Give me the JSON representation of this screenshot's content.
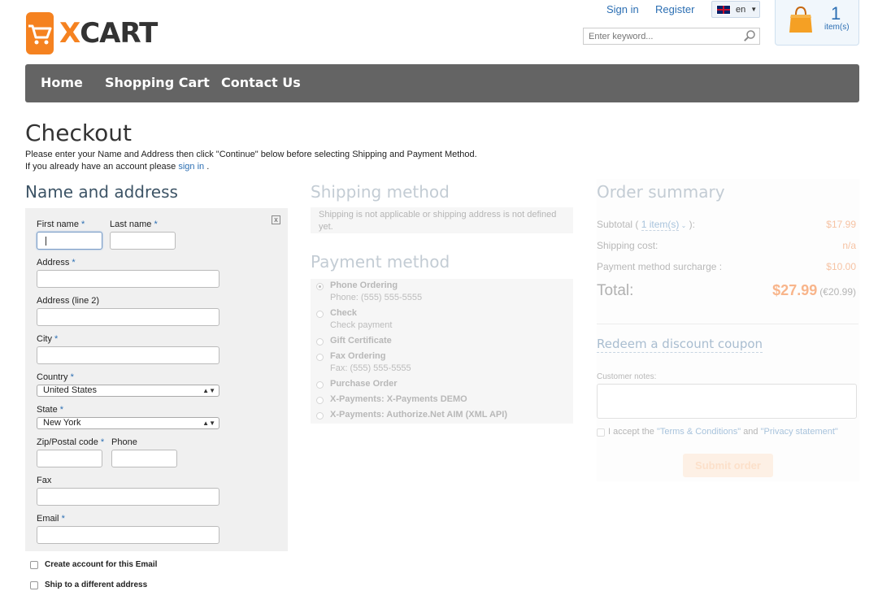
{
  "header": {
    "logo_text_x": "X",
    "logo_text_rest": "CART",
    "sign_in": "Sign in",
    "register": "Register",
    "language": "en",
    "search_placeholder": "Enter keyword...",
    "cart_count": "1",
    "cart_label": "item(s)"
  },
  "nav": {
    "home": "Home",
    "shopping_cart": "Shopping Cart",
    "contact_us": "Contact Us"
  },
  "page": {
    "title": "Checkout",
    "intro_line1": "Please enter your Name and Address then click \"Continue\" below before selecting Shipping and Payment Method.",
    "intro_line2_prefix": "If you already have an account please",
    "intro_sign_in": "sign in",
    "intro_line2_suffix": "."
  },
  "address": {
    "heading": "Name and address",
    "first_name": "First name",
    "last_name": "Last name",
    "address": "Address",
    "address2": "Address (line 2)",
    "city": "City",
    "country": "Country",
    "country_value": "United States",
    "state": "State",
    "state_value": "New York",
    "zip": "Zip/Postal code",
    "phone": "Phone",
    "fax": "Fax",
    "email": "Email",
    "required_mark": "*",
    "close_mark": "x",
    "create_account": "Create account for this Email",
    "ship_different": "Ship to a different address"
  },
  "shipping": {
    "heading": "Shipping method",
    "note": "Shipping is not applicable or shipping address is not defined yet."
  },
  "payment": {
    "heading": "Payment method",
    "methods": [
      {
        "name": "Phone Ordering",
        "sub": "Phone: (555) 555-5555",
        "selected": true
      },
      {
        "name": "Check",
        "sub": "Check payment",
        "selected": false
      },
      {
        "name": "Gift Certificate",
        "sub": "",
        "selected": false
      },
      {
        "name": "Fax Ordering",
        "sub": "Fax: (555) 555-5555",
        "selected": false
      },
      {
        "name": "Purchase Order",
        "sub": "",
        "selected": false
      },
      {
        "name": "X-Payments: X-Payments DEMO",
        "sub": "",
        "selected": false
      },
      {
        "name": "X-Payments: Authorize.Net AIM (XML API)",
        "sub": "",
        "selected": false
      }
    ]
  },
  "summary": {
    "heading": "Order summary",
    "subtotal_label": "Subtotal (",
    "subtotal_items": "1 item(s)",
    "subtotal_suffix": "):",
    "subtotal_value": "$17.99",
    "shipping_label": "Shipping cost:",
    "shipping_value": "n/a",
    "surcharge_label": "Payment method surcharge :",
    "surcharge_value": "$10.00",
    "total_label": "Total:",
    "total_value": "$27.99",
    "total_alt": "(€20.99)",
    "coupon": "Redeem a discount coupon",
    "notes_label": "Customer notes:",
    "accept_prefix": "I accept the",
    "terms": "\"Terms & Conditions\"",
    "and": "and",
    "privacy": "\"Privacy statement\"",
    "submit": "Submit order"
  },
  "colors": {
    "brand_orange": "#f58220",
    "link_blue": "#2c6fb3",
    "nav_bg": "#646464"
  }
}
